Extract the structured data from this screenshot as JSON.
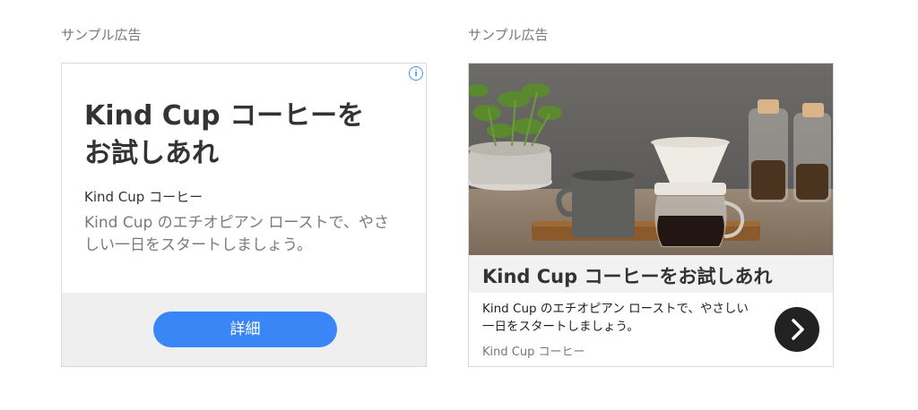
{
  "ads": [
    {
      "caption": "サンプル広告",
      "headline": "Kind Cup コーヒーをお試しあれ",
      "brand": "Kind Cup コーヒー",
      "description": "Kind Cup のエチオピアン ローストで、やさしい一日をスタートしましょう。",
      "cta_label": "詳細",
      "info_glyph": "i",
      "colors": {
        "cta": "#3b86f7",
        "info": "#3b9bea",
        "footer": "#efefef"
      }
    },
    {
      "caption": "サンプル広告",
      "headline": "Kind Cup コーヒーをお試しあれ",
      "description": "Kind Cup のエチオピアン ローストで、やさしい一日をスタートしましょう。",
      "brand": "Kind Cup コーヒー",
      "arrow_icon": "chevron-right-icon",
      "colors": {
        "arrow_bg": "#222222",
        "headband": "#f2f2f2"
      }
    }
  ]
}
